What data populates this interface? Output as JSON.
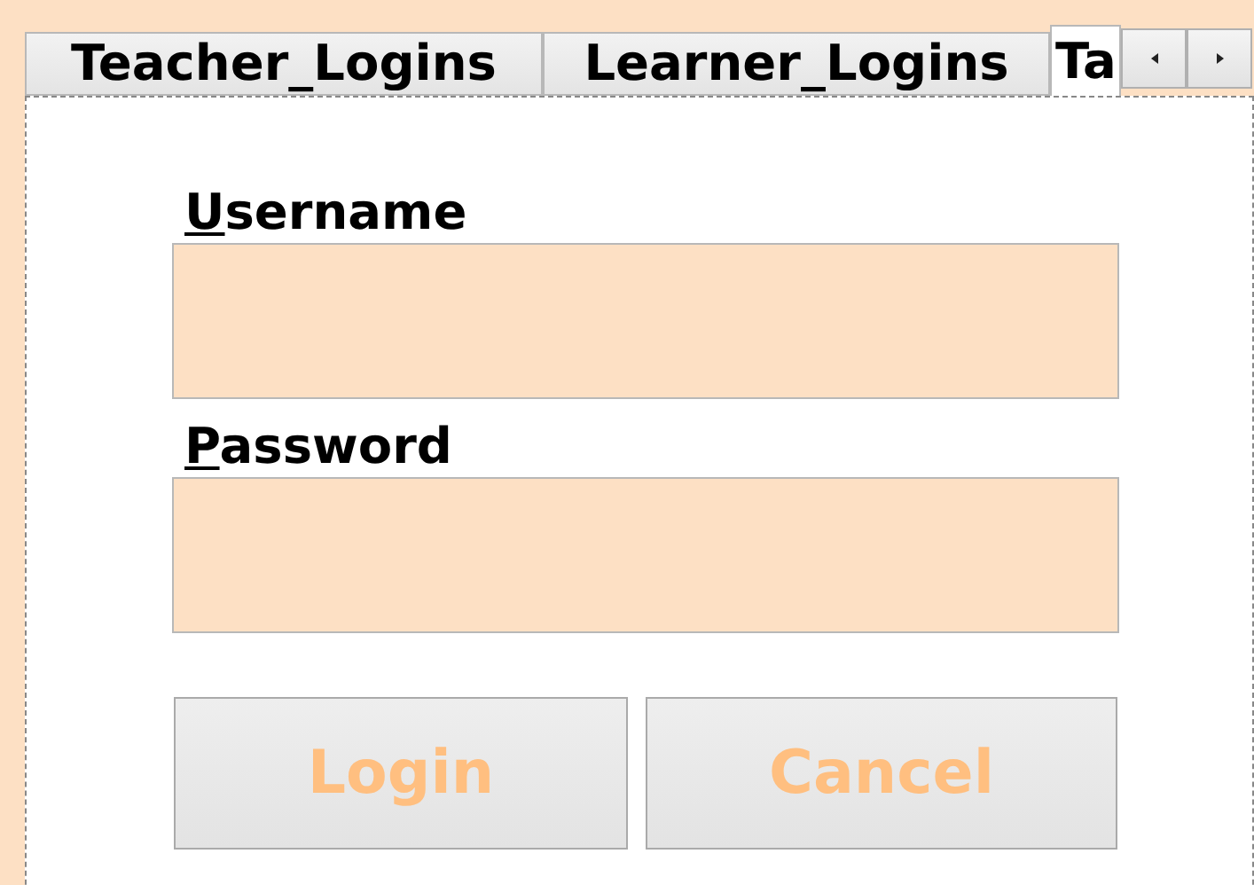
{
  "tabs": [
    {
      "label": "Teacher_Logins",
      "selected": false
    },
    {
      "label": "Learner_Logins",
      "selected": false
    },
    {
      "label": "Ta",
      "selected": true
    }
  ],
  "form": {
    "fields": [
      {
        "label": "Username"
      },
      {
        "label": "Password"
      }
    ],
    "buttons": [
      {
        "label": "Login",
        "disabled": true
      },
      {
        "label": "Cancel",
        "disabled": true
      }
    ]
  }
}
